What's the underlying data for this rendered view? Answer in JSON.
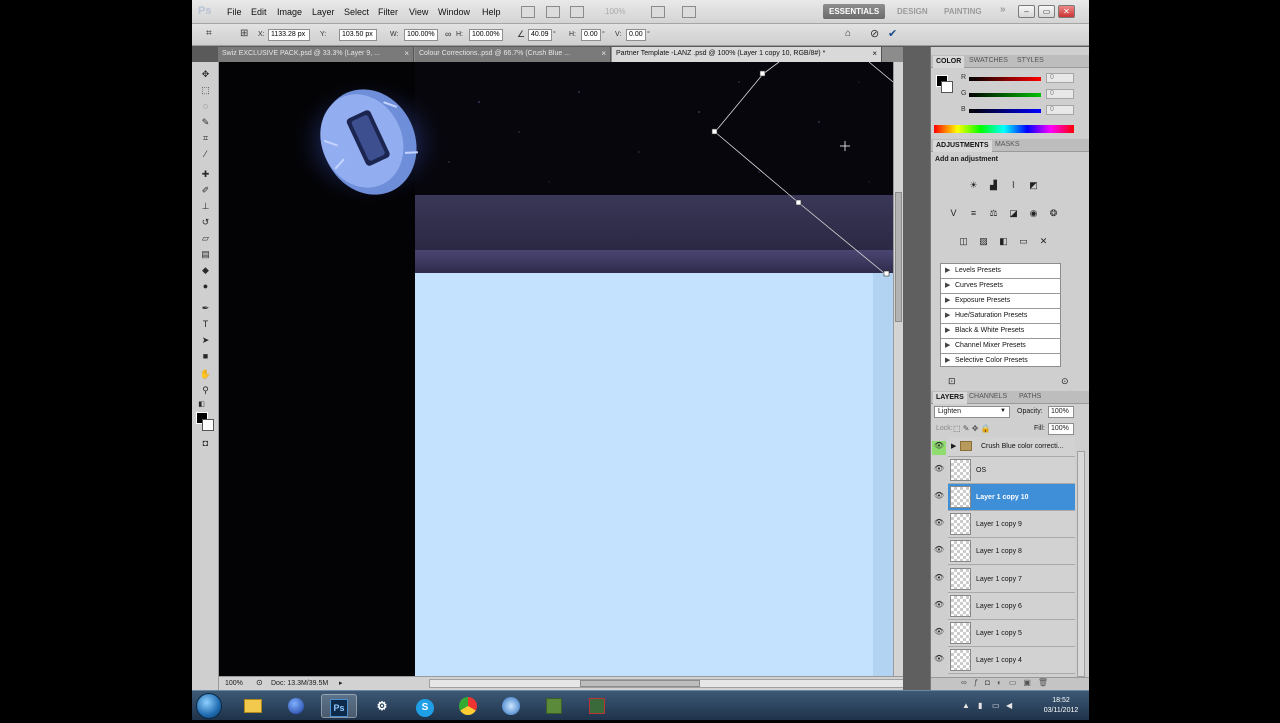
{
  "menubar": {
    "logo": "Ps",
    "items": [
      "File",
      "Edit",
      "Image",
      "Layer",
      "Select",
      "Filter",
      "View",
      "Window",
      "Help"
    ],
    "zoom_display": "100%",
    "workspaces": [
      "ESSENTIALS",
      "DESIGN",
      "PAINTING"
    ],
    "more": "»"
  },
  "options": {
    "x_label": "X:",
    "x_value": "1133.28 px",
    "y_label": "Y:",
    "y_value": "103.50 px",
    "w_label": "W:",
    "w_value": "100.00%",
    "h_label": "H:",
    "h_value": "100.00%",
    "angle_value": "40.09",
    "hskew_label": "H:",
    "hskew_value": "0.00",
    "vskew_label": "V:",
    "vskew_value": "0.00",
    "degree_symbol": "°"
  },
  "tabs": [
    {
      "label": "Swiz EXCLUSIVE PACK.psd @ 33.3% (Layer 9, ...",
      "close": "×"
    },
    {
      "label": "Colour Corrections..psd @ 66.7% (Crush Blue ...",
      "close": "×"
    },
    {
      "label": "Partner Template -LANZ .psd @ 100% (Layer 1 copy 10, RGB/8#) *",
      "close": "×"
    }
  ],
  "status": {
    "zoom": "100%",
    "doc": "Doc: 13.3M/39.5M"
  },
  "color_panel": {
    "tabs": [
      "COLOR",
      "SWATCHES",
      "STYLES"
    ],
    "sliders": [
      {
        "label": "R",
        "value": "0",
        "color": "#ff0000"
      },
      {
        "label": "G",
        "value": "0",
        "color": "#00c000"
      },
      {
        "label": "B",
        "value": "0",
        "color": "#0000ff"
      }
    ]
  },
  "adjustments": {
    "tabs": [
      "ADJUSTMENTS",
      "MASKS"
    ],
    "heading": "Add an adjustment",
    "presets": [
      "Levels Presets",
      "Curves Presets",
      "Exposure Presets",
      "Hue/Saturation Presets",
      "Black & White Presets",
      "Channel Mixer Presets",
      "Selective Color Presets"
    ]
  },
  "layers": {
    "tabs": [
      "LAYERS",
      "CHANNELS",
      "PATHS"
    ],
    "blend_mode": "Lighten",
    "opacity_label": "Opacity:",
    "opacity_value": "100%",
    "lock_label": "Lock:",
    "fill_label": "Fill:",
    "fill_value": "100%",
    "items": [
      {
        "name": "Crush Blue color correcti...",
        "type": "group"
      },
      {
        "name": "OS",
        "type": "layer"
      },
      {
        "name": "Layer 1 copy 10",
        "type": "layer",
        "selected": true
      },
      {
        "name": "Layer 1 copy 9",
        "type": "layer"
      },
      {
        "name": "Layer 1 copy 8",
        "type": "layer"
      },
      {
        "name": "Layer 1 copy 7",
        "type": "layer"
      },
      {
        "name": "Layer 1 copy 6",
        "type": "layer"
      },
      {
        "name": "Layer 1 copy 5",
        "type": "layer"
      },
      {
        "name": "Layer 1 copy 4",
        "type": "layer"
      }
    ]
  },
  "taskbar": {
    "apps": [
      "start-orb",
      "file-explorer",
      "steam-like",
      "photoshop",
      "steam",
      "skype",
      "chrome",
      "itunes",
      "minecraft",
      "game"
    ],
    "photoshop_label": "Ps",
    "skype_label": "S",
    "time": "18:52",
    "date": "03/11/2012"
  },
  "colors": {
    "accent": "#3f8ed8",
    "canvas_bg": "#07060d",
    "page_light": "#c4e2fd",
    "banner": "#2c2a46"
  }
}
